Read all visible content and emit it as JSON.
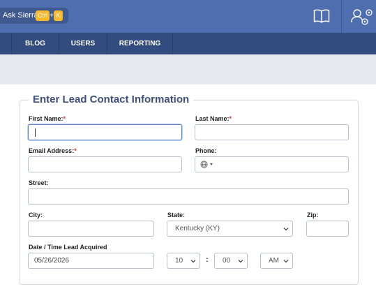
{
  "header": {
    "assistant_label": "Ask Sierra",
    "shortcut_ctrl": "Ctrl",
    "shortcut_plus": "+",
    "shortcut_key": "K",
    "book_icon": "book-icon",
    "users_icon": "users-settings-icon",
    "bar_color": "#4f6eaf"
  },
  "nav": {
    "items": [
      "BLOG",
      "USERS",
      "REPORTING"
    ],
    "bar_color": "#334c80"
  },
  "form": {
    "legend": "Enter Lead Contact Information",
    "required_marker": "*",
    "first_name": {
      "label": "First Name:",
      "value": ""
    },
    "last_name": {
      "label": "Last Name:",
      "value": ""
    },
    "email": {
      "label": "Email Address:",
      "value": ""
    },
    "phone": {
      "label": "Phone:",
      "value": "",
      "country_icon": "globe-icon"
    },
    "street": {
      "label": "Street:",
      "value": ""
    },
    "city": {
      "label": "City:",
      "value": ""
    },
    "state": {
      "label": "State:",
      "value": "Kentucky (KY)"
    },
    "zip": {
      "label": "Zip:",
      "value": ""
    },
    "acquired": {
      "label": "Date / Time Lead Acquired",
      "date": "05/26/2026",
      "hour": "10",
      "separator": ":",
      "minute": "00",
      "meridiem": "AM"
    }
  }
}
